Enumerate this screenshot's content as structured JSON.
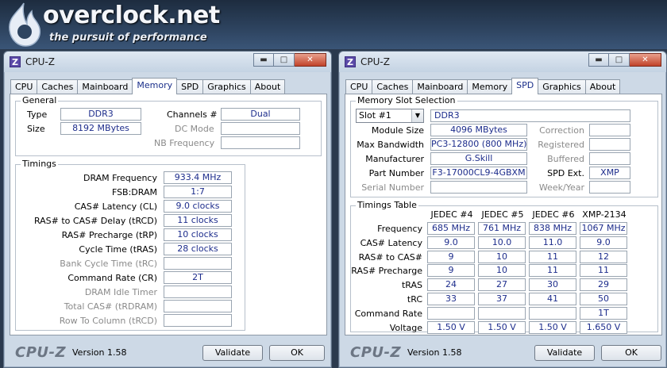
{
  "banner": {
    "logo_text": "overclock.net",
    "tagline": "the pursuit of performance"
  },
  "left_window": {
    "title": "CPU-Z",
    "tabs": [
      "CPU",
      "Caches",
      "Mainboard",
      "Memory",
      "SPD",
      "Graphics",
      "About"
    ],
    "active_tab": "Memory",
    "general": {
      "label": "General",
      "type_label": "Type",
      "type_value": "DDR3",
      "size_label": "Size",
      "size_value": "8192 MBytes",
      "channels_label": "Channels #",
      "channels_value": "Dual",
      "dc_mode_label": "DC Mode",
      "dc_mode_value": "",
      "nb_freq_label": "NB Frequency",
      "nb_freq_value": ""
    },
    "timings": {
      "label": "Timings",
      "rows": [
        {
          "label": "DRAM Frequency",
          "value": "933.4 MHz",
          "dim": false
        },
        {
          "label": "FSB:DRAM",
          "value": "1:7",
          "dim": false
        },
        {
          "label": "CAS# Latency (CL)",
          "value": "9.0 clocks",
          "dim": false
        },
        {
          "label": "RAS# to CAS# Delay (tRCD)",
          "value": "11 clocks",
          "dim": false
        },
        {
          "label": "RAS# Precharge (tRP)",
          "value": "10 clocks",
          "dim": false
        },
        {
          "label": "Cycle Time (tRAS)",
          "value": "28 clocks",
          "dim": false
        },
        {
          "label": "Bank Cycle Time (tRC)",
          "value": "",
          "dim": true
        },
        {
          "label": "Command Rate (CR)",
          "value": "2T",
          "dim": false
        },
        {
          "label": "DRAM Idle Timer",
          "value": "",
          "dim": true
        },
        {
          "label": "Total CAS# (tRDRAM)",
          "value": "",
          "dim": true
        },
        {
          "label": "Row To Column (tRCD)",
          "value": "",
          "dim": true
        }
      ]
    },
    "footer": {
      "logo": "CPU-Z",
      "version": "Version 1.58",
      "validate": "Validate",
      "ok": "OK"
    }
  },
  "right_window": {
    "title": "CPU-Z",
    "tabs": [
      "CPU",
      "Caches",
      "Mainboard",
      "Memory",
      "SPD",
      "Graphics",
      "About"
    ],
    "active_tab": "SPD",
    "slot_selection": {
      "label": "Memory Slot Selection",
      "slot_value": "Slot #1",
      "type_value": "DDR3",
      "module_size_label": "Module Size",
      "module_size_value": "4096 MBytes",
      "max_bw_label": "Max Bandwidth",
      "max_bw_value": "PC3-12800 (800 MHz)",
      "manufacturer_label": "Manufacturer",
      "manufacturer_value": "G.Skill",
      "part_label": "Part Number",
      "part_value": "F3-17000CL9-4GBXM",
      "serial_label": "Serial Number",
      "serial_value": "",
      "correction_label": "Correction",
      "correction_value": "",
      "registered_label": "Registered",
      "registered_value": "",
      "buffered_label": "Buffered",
      "buffered_value": "",
      "spd_ext_label": "SPD Ext.",
      "spd_ext_value": "XMP",
      "week_year_label": "Week/Year",
      "week_year_value": ""
    },
    "timings_table": {
      "label": "Timings Table",
      "columns": [
        "JEDEC #4",
        "JEDEC #5",
        "JEDEC #6",
        "XMP-2134"
      ],
      "rows": [
        {
          "label": "Frequency",
          "values": [
            "685 MHz",
            "761 MHz",
            "838 MHz",
            "1067 MHz"
          ]
        },
        {
          "label": "CAS# Latency",
          "values": [
            "9.0",
            "10.0",
            "11.0",
            "9.0"
          ]
        },
        {
          "label": "RAS# to CAS#",
          "values": [
            "9",
            "10",
            "11",
            "12"
          ]
        },
        {
          "label": "RAS# Precharge",
          "values": [
            "9",
            "10",
            "11",
            "11"
          ]
        },
        {
          "label": "tRAS",
          "values": [
            "24",
            "27",
            "30",
            "29"
          ]
        },
        {
          "label": "tRC",
          "values": [
            "33",
            "37",
            "41",
            "50"
          ]
        },
        {
          "label": "Command Rate",
          "values": [
            "",
            "",
            "",
            "1T"
          ]
        },
        {
          "label": "Voltage",
          "values": [
            "1.50 V",
            "1.50 V",
            "1.50 V",
            "1.650 V"
          ]
        }
      ]
    },
    "footer": {
      "logo": "CPU-Z",
      "version": "Version 1.58",
      "validate": "Validate",
      "ok": "OK"
    }
  },
  "colors": {
    "value_text": "#1d2d8c",
    "window_bg": "#cdd9e6",
    "close_button": "#c1432a",
    "app_icon": "#5b4aa8"
  }
}
